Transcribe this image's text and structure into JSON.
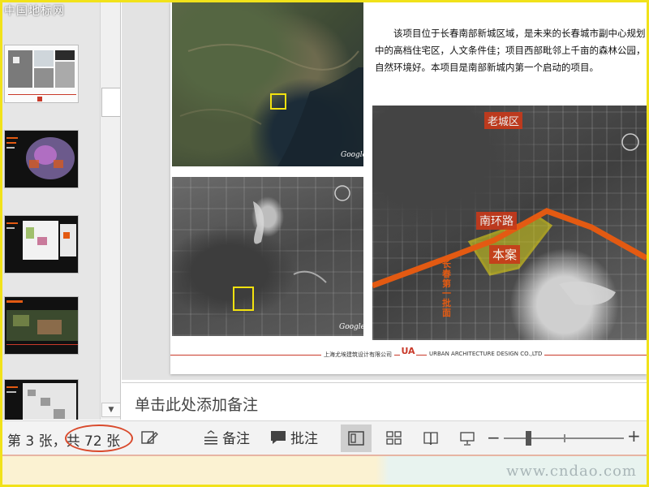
{
  "thumbnails": {
    "top_label": "中国地标网",
    "items": [
      {
        "index": 1,
        "style": "light"
      },
      {
        "index": 2,
        "style": "dark"
      },
      {
        "index": 3,
        "style": "dark"
      },
      {
        "index": 4,
        "style": "dark"
      },
      {
        "index": 5,
        "style": "dark"
      }
    ]
  },
  "slide": {
    "description": "该项目位于长春南部新城区域，是未来的长春城市副中心规划中的高档住宅区，人文条件佳；项目西部毗邻上千亩的森林公园，自然环境好。本项目是南部新城内第一个启动的项目。",
    "map_labels": {
      "old_city": "老城区",
      "south_ring_road": "南环路",
      "this_project": "本案",
      "side_zone": "长春第一批面"
    },
    "footer_cn": "上海尤埃建筑设计有限公司",
    "footer_en": "URBAN ARCHITECTURE DESIGN CO.,LTD",
    "logo_letters": "UA",
    "google_mark": "Google"
  },
  "notes": {
    "placeholder": "单击此处添加备注"
  },
  "statusbar": {
    "slide_prefix": "第 3 张，",
    "slide_total": "共 72 张",
    "notes_label": "备注",
    "comments_label": "批注"
  },
  "watermark": "www.cndao.com",
  "colors": {
    "accent_red": "#c93a2a",
    "road_orange": "#e35a12",
    "marker_yellow": "#f3e20f",
    "highlight_circle": "#d94a2c",
    "frame_yellow": "#f1e21a"
  },
  "icons": [
    "chevron-down-icon",
    "edit-icon",
    "notes-icon",
    "comment-icon",
    "normal-view-icon",
    "slide-sorter-icon",
    "reading-view-icon",
    "slideshow-icon"
  ]
}
